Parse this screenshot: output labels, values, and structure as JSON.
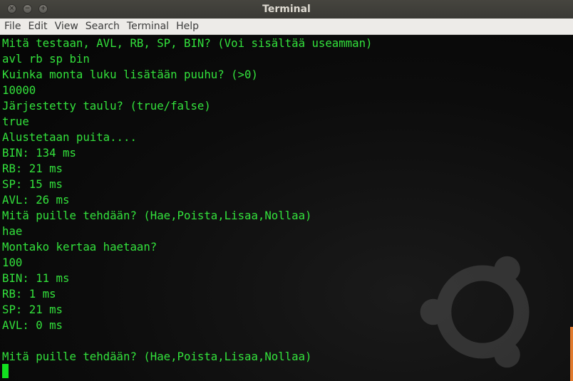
{
  "window": {
    "title": "Terminal",
    "buttons": [
      "×",
      "−",
      "+"
    ]
  },
  "menu": [
    "File",
    "Edit",
    "View",
    "Search",
    "Terminal",
    "Help"
  ],
  "terminal": {
    "lines": [
      "Mitä testaan, AVL, RB, SP, BIN? (Voi sisältää useamman)",
      "avl rb sp bin",
      "Kuinka monta luku lisätään puuhu? (>0)",
      "10000",
      "Järjestetty taulu? (true/false)",
      "true",
      "Alustetaan puita....",
      "BIN: 134 ms",
      "RB: 21 ms",
      "SP: 15 ms",
      "AVL: 26 ms",
      "Mitä puille tehdään? (Hae,Poista,Lisaa,Nollaa)",
      "hae",
      "Montako kertaa haetaan?",
      "100",
      "BIN: 11 ms",
      "RB: 1 ms",
      "SP: 21 ms",
      "AVL: 0 ms",
      "",
      "Mitä puille tehdään? (Hae,Poista,Lisaa,Nollaa)"
    ]
  },
  "colors": {
    "text": "#33e23c",
    "background": "#0c0c0c",
    "cursor": "#12e01f",
    "scrollbar": "#e07a2e"
  }
}
